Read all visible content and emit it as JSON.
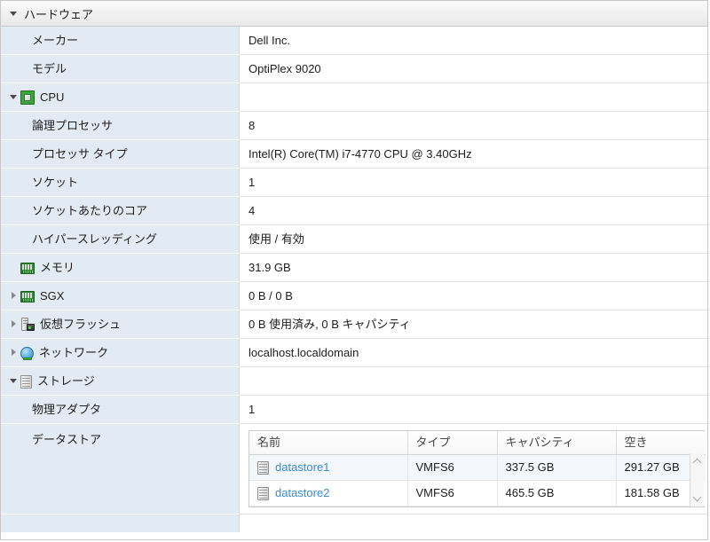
{
  "panel": {
    "header": {
      "title": "ハードウェア",
      "twisty": "chevron-down-icon",
      "expanded": true
    },
    "colors": {
      "label_bg": "#e2ebf3",
      "value_bg": "#ffffff",
      "header_bg": "#f1f1f1",
      "link": "#3b8bd0",
      "border": "#cccccc"
    },
    "rows": [
      {
        "label": "メーカー",
        "value": "Dell Inc.",
        "indent": 1,
        "twisty": "none",
        "icon": "none"
      },
      {
        "label": "モデル",
        "value": "OptiPlex 9020",
        "indent": 1,
        "twisty": "none",
        "icon": "none"
      },
      {
        "label": "CPU",
        "value": "",
        "indent": 0,
        "twisty": "down",
        "icon": "cpu-icon"
      },
      {
        "label": "論理プロセッサ",
        "value": "8",
        "indent": 2,
        "twisty": "none",
        "icon": "none"
      },
      {
        "label": "プロセッサ タイプ",
        "value": "Intel(R) Core(TM) i7-4770 CPU @ 3.40GHz",
        "indent": 2,
        "twisty": "none",
        "icon": "none"
      },
      {
        "label": "ソケット",
        "value": "1",
        "indent": 2,
        "twisty": "none",
        "icon": "none"
      },
      {
        "label": "ソケットあたりのコア",
        "value": "4",
        "indent": 2,
        "twisty": "none",
        "icon": "none"
      },
      {
        "label": "ハイパースレッディング",
        "value": "使用 / 有効",
        "indent": 2,
        "twisty": "none",
        "icon": "none"
      },
      {
        "label": "メモリ",
        "value": "31.9 GB",
        "indent": 0,
        "twisty": "none",
        "icon": "memory-icon"
      },
      {
        "label": "SGX",
        "value": "0 B / 0 B",
        "indent": 0,
        "twisty": "right",
        "icon": "memory-icon"
      },
      {
        "label": "仮想フラッシュ",
        "value": "0 B 使用済み, 0 B キャパシティ",
        "indent": 0,
        "twisty": "right",
        "icon": "virtual-flash-icon"
      },
      {
        "label": "ネットワーク",
        "value": "localhost.localdomain",
        "indent": 0,
        "twisty": "right",
        "icon": "network-icon"
      },
      {
        "label": "ストレージ",
        "value": "",
        "indent": 0,
        "twisty": "down",
        "icon": "storage-icon"
      },
      {
        "label": "物理アダプタ",
        "value": "1",
        "indent": 2,
        "twisty": "none",
        "icon": "none"
      },
      {
        "label": "データストア",
        "value": "",
        "indent": 2,
        "twisty": "none",
        "icon": "none",
        "table": "datastores"
      }
    ],
    "datastores": {
      "columns": [
        "名前",
        "タイプ",
        "キャパシティ",
        "空き"
      ],
      "rows": [
        {
          "icon": "datastore-icon",
          "name": "datastore1",
          "type": "VMFS6",
          "capacity": "337.5 GB",
          "free": "291.27 GB"
        },
        {
          "icon": "datastore-icon",
          "name": "datastore2",
          "type": "VMFS6",
          "capacity": "465.5 GB",
          "free": "181.58 GB"
        }
      ],
      "scrollbar": {
        "up": "scroll-up-arrow",
        "down": "scroll-down-arrow"
      }
    }
  }
}
